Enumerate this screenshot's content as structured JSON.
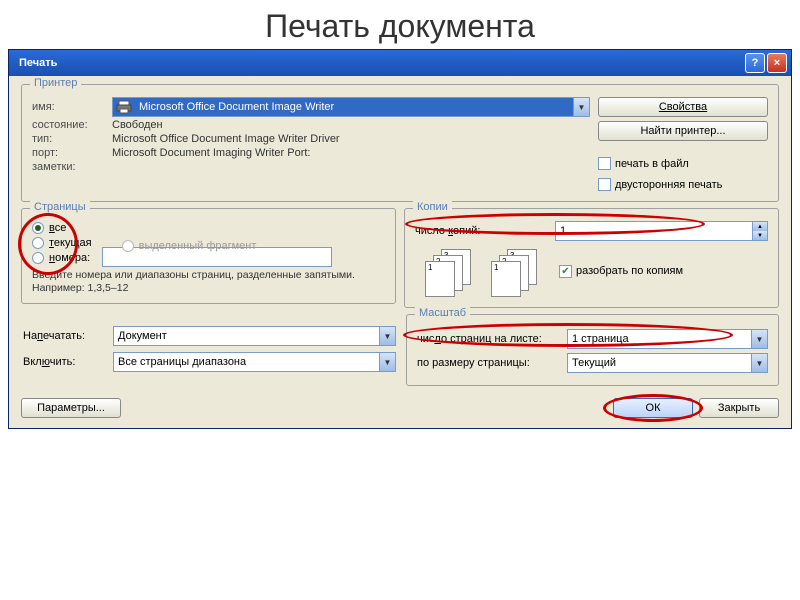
{
  "slide_title": "Печать документа",
  "titlebar": {
    "title": "Печать",
    "help": "?",
    "close": "×"
  },
  "printer": {
    "legend": "Принтер",
    "name_lbl": "имя:",
    "name_val": "Microsoft Office Document Image Writer",
    "status_lbl": "состояние:",
    "status_val": "Свободен",
    "type_lbl": "тип:",
    "type_val": "Microsoft Office Document Image Writer Driver",
    "port_lbl": "порт:",
    "port_val": "Microsoft Document Imaging Writer Port:",
    "notes_lbl": "заметки:",
    "properties_btn": "Свойства",
    "find_btn": "Найти принтер...",
    "to_file_chk": "печать в файл",
    "duplex_chk": "двусторонняя печать"
  },
  "pages": {
    "legend": "Страницы",
    "all": "все",
    "current": "текущая",
    "selection": "выделенный фрагмент",
    "numbers": "номера:",
    "hint": "Введите номера или диапазоны страниц, разделенные запятыми. Например: 1,3,5–12"
  },
  "copies": {
    "legend": "Копии",
    "count_lbl": "число копий:",
    "count_val": "1",
    "collate": "разобрать по копиям"
  },
  "what": {
    "print_lbl": "Напечатать:",
    "print_val": "Документ",
    "include_lbl": "Включить:",
    "include_val": "Все страницы диапазона"
  },
  "scale": {
    "legend": "Масштаб",
    "per_sheet_lbl": "число страниц на листе:",
    "per_sheet_val": "1 страница",
    "fit_lbl": "по размеру страницы:",
    "fit_val": "Текущий"
  },
  "footer": {
    "params": "Параметры...",
    "ok": "ОК",
    "close": "Закрыть"
  }
}
